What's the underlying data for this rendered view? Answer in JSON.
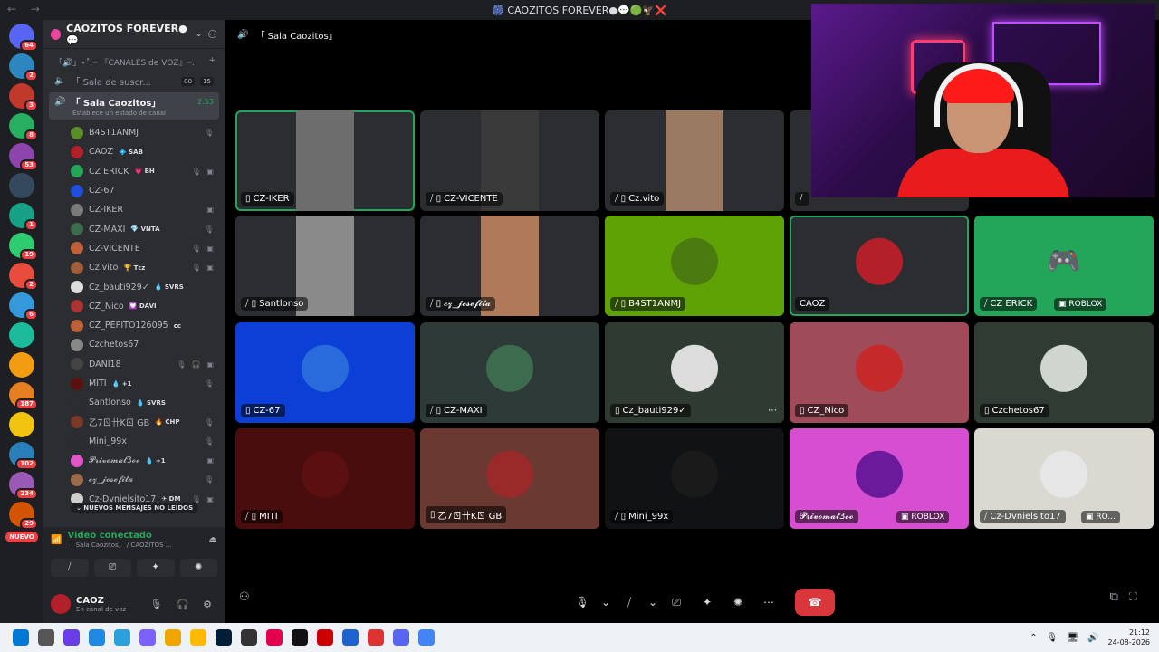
{
  "window": {
    "title": "🎆 CAOZITOS FOREVER●💬🟢🦅❌",
    "nav": "← →"
  },
  "rail": {
    "servers": [
      {
        "color": "#5865f2",
        "badge": "64"
      },
      {
        "color": "#2e86c1",
        "badge": "2"
      },
      {
        "color": "#c0392b",
        "badge": "3"
      },
      {
        "color": "#27ae60",
        "badge": "8"
      },
      {
        "color": "#8e44ad",
        "badge": "53"
      },
      {
        "color": "#34495e",
        "badge": ""
      },
      {
        "color": "#16a085",
        "badge": "1"
      },
      {
        "color": "#2ecc71",
        "badge": "19"
      },
      {
        "color": "#e74c3c",
        "badge": "2"
      },
      {
        "color": "#3498db",
        "badge": "6"
      },
      {
        "color": "#1abc9c",
        "badge": ""
      },
      {
        "color": "#f39c12",
        "badge": ""
      },
      {
        "color": "#e67e22",
        "badge": "187"
      },
      {
        "color": "#f1c40f",
        "badge": ""
      },
      {
        "color": "#2980b9",
        "badge": "102"
      },
      {
        "color": "#9b59b6",
        "badge": "234"
      },
      {
        "color": "#d35400",
        "badge": "29"
      }
    ],
    "new_label": "NUEVO"
  },
  "guild": {
    "name": "CAOZITOS FOREVER●💬",
    "category": "「🔊」⋆˚.─ 『CANALES de VOZ』─.",
    "channels": [
      {
        "name": "「 Sala de suscr...",
        "pill1": "00",
        "pill2": "15"
      }
    ],
    "active_channel": {
      "name": "「 Sala Caozitos」",
      "time": "2:53",
      "status": "Establece un estado de canal"
    },
    "members": [
      {
        "name": "B4ST1ANMJ",
        "tag": "",
        "color": "#5b8c2a",
        "icons": "🎙"
      },
      {
        "name": "CAOZ",
        "tag": "💠 SAB",
        "color": "#b3202a",
        "icons": ""
      },
      {
        "name": "CZ ERICK",
        "tag": "💗 BH",
        "color": "#23a55a",
        "icons": "🎙 ▣"
      },
      {
        "name": "CZ-67",
        "tag": "",
        "color": "#1f4fd8",
        "icons": ""
      },
      {
        "name": "CZ-IKER",
        "tag": "",
        "color": "#7a7a7a",
        "icons": "▣"
      },
      {
        "name": "CZ-MAXI",
        "tag": "💎 VNTA",
        "color": "#3d6b4e",
        "icons": "🎙"
      },
      {
        "name": "CZ-VICENTE",
        "tag": "",
        "color": "#c0603a",
        "icons": "🎙 ▣"
      },
      {
        "name": "Cz.vito",
        "tag": "🏆 Tεz",
        "color": "#a05e3a",
        "icons": "🎙 ▣"
      },
      {
        "name": "Cz_bauti929✓",
        "tag": "💧 SVRS",
        "color": "#dcdcdc",
        "icons": ""
      },
      {
        "name": "CZ_Nico",
        "tag": "💟 DAVI",
        "color": "#a33",
        "icons": ""
      },
      {
        "name": "CZ_PEPITO126095",
        "tag": "cc",
        "color": "#c0603a",
        "icons": ""
      },
      {
        "name": "Czchetos67",
        "tag": "",
        "color": "#888",
        "icons": ""
      },
      {
        "name": "DANI18",
        "tag": "",
        "color": "#444",
        "icons": "🎙 🎧 ▣"
      },
      {
        "name": "MITI",
        "tag": "💧 +1",
        "color": "#5a1010",
        "icons": "🎙"
      },
      {
        "name": "Santlonso",
        "tag": "💧 SVRS",
        "color": "#2b2d31",
        "icons": ""
      },
      {
        "name": "乙7ㄖ卄Kㄖ GB",
        "tag": "🔥 CHP",
        "color": "#7a3a2a",
        "icons": "🎙"
      },
      {
        "name": "Mini_99x",
        "tag": "",
        "color": "#2b2d31",
        "icons": "🎙"
      },
      {
        "name": "𝓟𝓻𝓲𝓿𝓸𝓶𝓪𝓽3𝓸𝓸",
        "tag": "💧 +1",
        "color": "#e056c9",
        "icons": "▣"
      },
      {
        "name": "𝓬𝔃_𝓳𝓸𝓼𝓮𝓯𝓲𝓽𝓪",
        "tag": "",
        "color": "#9a6a4a",
        "icons": "🎙"
      },
      {
        "name": "Cz-Dvnielsito17",
        "tag": "✈ DM",
        "color": "#cfcfcf",
        "icons": "🎙 ▣"
      }
    ],
    "new_messages": "⌄ NUEVOS MENSAJES NO LEÍDOS"
  },
  "voice_status": {
    "title": "Video conectado",
    "subtitle": "「 Sala Caozitos」 / CAOZITOS ..."
  },
  "user": {
    "name": "CAOZ",
    "status": "En canal de voz"
  },
  "stage": {
    "title": "「 Sala Caozitos」",
    "tiles": [
      {
        "name": "CZ-IKER",
        "icon": "▯",
        "bg": "#2b2d31",
        "cam": "#6d6d6d",
        "speaking": true
      },
      {
        "name": "CZ-VICENTE",
        "icon": "⧸ ▯",
        "bg": "#2b2d31",
        "cam": "#3a3a3a",
        "speaking": false
      },
      {
        "name": "Cz.vito",
        "icon": "⧸ ▯",
        "bg": "#2b2d31",
        "cam": "#9a7a60",
        "speaking": false
      },
      {
        "name": "",
        "icon": "⧸",
        "bg": "#2b2d31",
        "cam": "",
        "speaking": false
      },
      {
        "name": "Santlonso",
        "icon": "⧸ ▯",
        "bg": "#2b2d31",
        "cam": "#8a8a8a",
        "speaking": false
      },
      {
        "name": "𝓬𝔃_𝓳𝓸𝓼𝓮𝓯𝓲𝓽𝓪",
        "icon": "⧸ ▯",
        "bg": "#2b2d31",
        "cam": "#b07a5a",
        "speaking": false
      },
      {
        "name": "B4ST1ANMJ",
        "icon": "⧸ ▯",
        "bg": "#5ea205",
        "avatar": "#4a7a10",
        "speaking": false
      },
      {
        "name": "CAOZ",
        "icon": "",
        "bg": "#2b2d31",
        "avatar": "#b3202a",
        "speaking": true
      },
      {
        "name": "CZ ERICK",
        "icon": "⧸",
        "bg": "#23a55a",
        "avatar": "discord",
        "extra": "▣ ROBLOX",
        "speaking": false
      },
      {
        "name": "CZ-67",
        "icon": "▯",
        "bg": "#0b3fd6",
        "avatar": "#2a6bdc",
        "speaking": false
      },
      {
        "name": "CZ-MAXI",
        "icon": "⧸ ▯",
        "bg": "#2e3a38",
        "avatar": "#3d6b4e",
        "speaking": false
      },
      {
        "name": "Cz_bauti929✓",
        "icon": "▯",
        "bg": "#2f3b30",
        "avatar": "#dcdcdc",
        "speaking": false,
        "more": "⋯"
      },
      {
        "name": "CZ_Nico",
        "icon": "▯",
        "bg": "#a04b5a",
        "avatar": "#c52a2a",
        "speaking": false
      },
      {
        "name": "Czchetos67",
        "icon": "▯",
        "bg": "#2f3b33",
        "avatar": "#cfd6d0",
        "speaking": false
      },
      {
        "name": "MITI",
        "icon": "⧸ ▯",
        "bg": "#4a0d0d",
        "avatar": "#5a1010",
        "speaking": false
      },
      {
        "name": "乙7ㄖ卄Kㄖ GB",
        "icon": "▯",
        "bg": "#6a3a32",
        "avatar": "#9a2a2a",
        "speaking": false
      },
      {
        "name": "Mini_99x",
        "icon": "⧸ ▯",
        "bg": "#111214",
        "avatar": "#1a1a1a",
        "speaking": false
      },
      {
        "name": "𝓟𝓻𝓲𝓿𝓸𝓶𝓪𝓽3𝓸𝓸",
        "icon": "",
        "bg": "#d64fd0",
        "avatar": "#6a1a9a",
        "extra": "▣ ROBLOX",
        "speaking": false
      },
      {
        "name": "Cz-Dvnielsito17",
        "icon": "⧸",
        "bg": "#d9d9d2",
        "avatar": "#e6e6e6",
        "extra": "▣ RO...",
        "speaking": false
      }
    ]
  },
  "controls": {
    "mic": "🎙",
    "mic_caret": "⌄",
    "camera": "⧸",
    "cam_caret": "⌄",
    "screen": "⎚",
    "activities": "✦",
    "soundboard": "✺",
    "more": "⋯",
    "hangup": "☎"
  },
  "taskbar": {
    "time": "21:12",
    "date": "24-08-2026",
    "apps": [
      "#0078d4",
      "#555",
      "#6a3de8",
      "#1e88e5",
      "#2aa0dc",
      "#7b61ff",
      "#f0a500",
      "#ffb900",
      "#001e36",
      "#333",
      "#e3004f",
      "#111",
      "#c00",
      "#1e62d0",
      "#d33",
      "#5865f2",
      "#4285f4"
    ]
  },
  "colors": {
    "accent": "#5865f2",
    "speaking": "#23a55a",
    "danger": "#da373c"
  }
}
